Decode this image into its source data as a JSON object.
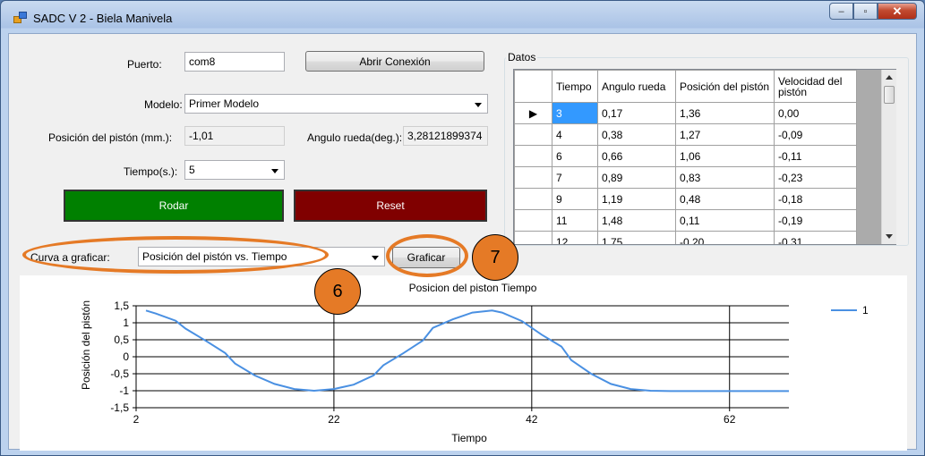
{
  "window": {
    "title": "SADC V 2 - Biela Manivela",
    "buttons": {
      "minimize": "‒",
      "maximize": "▫",
      "close": "✕"
    }
  },
  "form": {
    "puerto_label": "Puerto:",
    "puerto_value": "com8",
    "abrir_label": "Abrir Conexión",
    "modelo_label": "Modelo:",
    "modelo_value": "Primer Modelo",
    "posicion_label": "Posición del pistón (mm.):",
    "posicion_value": "-1,01",
    "angulo_label": "Angulo rueda(deg.):",
    "angulo_value": "3,28121899374",
    "tiempo_label": "Tiempo(s.):",
    "tiempo_value": "5",
    "rodar_label": "Rodar",
    "reset_label": "Reset",
    "curva_label": "Curva a graficar:",
    "curva_value": "Posición del pistón vs. Tiempo",
    "graficar_label": "Graficar"
  },
  "datos": {
    "title": "Datos",
    "columns": [
      "Tiempo",
      "Angulo rueda",
      "Posición del pistón",
      "Velocidad del pistón"
    ],
    "rows": [
      [
        "3",
        "0,17",
        "1,36",
        "0,00"
      ],
      [
        "4",
        "0,38",
        "1,27",
        "-0,09"
      ],
      [
        "6",
        "0,66",
        "1,06",
        "-0,11"
      ],
      [
        "7",
        "0,89",
        "0,83",
        "-0,23"
      ],
      [
        "9",
        "1,19",
        "0,48",
        "-0,18"
      ],
      [
        "11",
        "1,48",
        "0,11",
        "-0,19"
      ],
      [
        "12",
        "1,75",
        "-0,20",
        "-0,31"
      ]
    ],
    "current_row_marker": "▶"
  },
  "annotations": {
    "six": "6",
    "seven": "7"
  },
  "colors": {
    "accent": "#e57a26",
    "rodar": "#008000",
    "reset": "#800000",
    "series": "#4a90e2"
  },
  "chart_data": {
    "type": "line",
    "title": "Posición del pistón vs. Tiempo",
    "title_visible": "Posicion del piston   Tiempo",
    "xlabel": "Tiempo",
    "ylabel": "Posición del pistón",
    "xlim": [
      2,
      68
    ],
    "ylim": [
      -1.5,
      1.5
    ],
    "xticks": [
      "2",
      "22",
      "42",
      "62"
    ],
    "yticks": [
      "1,5",
      "1",
      "0,5",
      "0",
      "-0,5",
      "-1",
      "-1,5"
    ],
    "legend_position": "top-right",
    "series": [
      {
        "name": "1",
        "x": [
          3,
          4,
          6,
          7,
          9,
          11,
          12,
          14,
          16,
          18,
          20,
          22,
          24,
          26,
          27,
          29,
          31,
          32,
          34,
          36,
          38,
          39,
          41,
          43,
          45,
          46,
          48,
          50,
          52,
          54,
          56,
          58,
          60,
          62,
          64,
          66,
          68
        ],
        "y": [
          1.36,
          1.27,
          1.06,
          0.83,
          0.48,
          0.11,
          -0.2,
          -0.55,
          -0.8,
          -0.95,
          -1.0,
          -0.95,
          -0.82,
          -0.55,
          -0.25,
          0.1,
          0.48,
          0.85,
          1.1,
          1.3,
          1.36,
          1.3,
          1.05,
          0.65,
          0.3,
          -0.1,
          -0.5,
          -0.8,
          -0.95,
          -1.0,
          -1.01,
          -1.01,
          -1.01,
          -1.01,
          -1.01,
          -1.01,
          -1.01
        ]
      }
    ]
  }
}
